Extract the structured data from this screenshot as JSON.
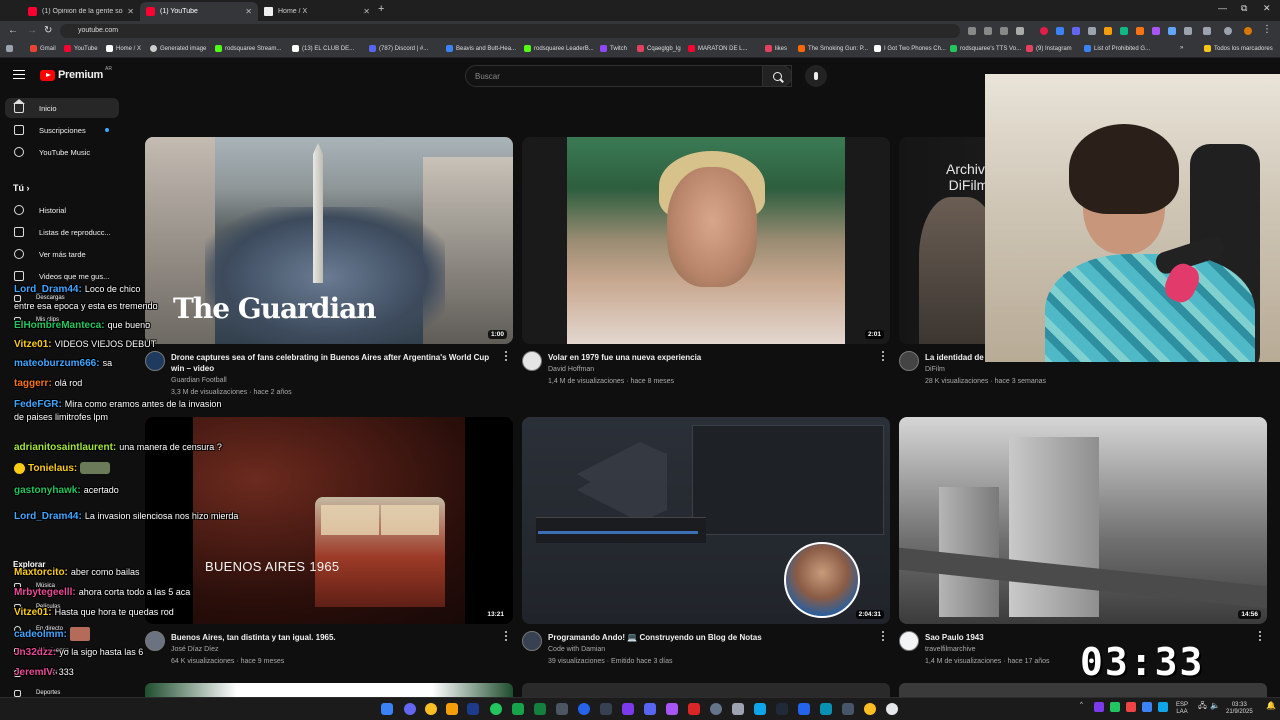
{
  "browser": {
    "tabs": [
      {
        "label": "(1) Opinion de la gente sobre e",
        "color": "#ff0033",
        "active": false
      },
      {
        "label": "(1) YouTube",
        "color": "#ff0033",
        "active": true
      },
      {
        "label": "Home / X",
        "color": "#ffffff",
        "active": false
      }
    ],
    "new_tab": "+",
    "url": "youtube.com",
    "window_controls": [
      "—",
      "⧉",
      "✕"
    ],
    "bookmarks": [
      {
        "label": "Gmail",
        "color": "#ea4335"
      },
      {
        "label": "YouTube",
        "color": "#ff0033"
      },
      {
        "label": "Home / X",
        "color": "#ffffff"
      },
      {
        "label": "Generated image",
        "color": "#cccccc"
      },
      {
        "label": "rodsquaree Stream...",
        "color": "#53fc18"
      },
      {
        "label": "(13) EL CLUB DE...",
        "color": "#ffffff"
      },
      {
        "label": "(787) Discord | #...",
        "color": "#5865f2"
      },
      {
        "label": "Beavis and Butt-Hea...",
        "color": "#3b82f6"
      },
      {
        "label": "rodsquaree LeaderB...",
        "color": "#53fc18"
      },
      {
        "label": "Twitch",
        "color": "#9146ff"
      },
      {
        "label": "Cqaeglgb_lg",
        "color": "#e4405f"
      },
      {
        "label": "MARATON DE L...",
        "color": "#ff0033"
      },
      {
        "label": "likes",
        "color": "#e4405f"
      },
      {
        "label": "The Smoking Gun: P...",
        "color": "#ff6600"
      },
      {
        "label": "I Got Two Phones Ch...",
        "color": "#ffffff"
      },
      {
        "label": "rodsquaree's TTS Vo...",
        "color": "#22c55e"
      },
      {
        "label": "(9) Instagram",
        "color": "#e4405f"
      },
      {
        "label": "List of Prohibited G...",
        "color": "#3b82f6"
      },
      {
        "label": "Todos los marcadores",
        "color": "#f5c518"
      }
    ]
  },
  "youtube": {
    "logo_text": "Premium",
    "logo_region": "AR",
    "search_placeholder": "Buscar",
    "sidebar": {
      "primary": [
        {
          "label": "Inicio",
          "icon": "home-icon",
          "active": true
        },
        {
          "label": "Suscripciones",
          "icon": "subscriptions-icon",
          "active": false
        },
        {
          "label": "YouTube Music",
          "icon": "music-icon",
          "active": false
        }
      ],
      "you_header": "Tú",
      "you_items": [
        {
          "label": "Historial",
          "icon": "history-icon"
        },
        {
          "label": "Listas de reproducc...",
          "icon": "playlist-icon"
        },
        {
          "label": "Ver más tarde",
          "icon": "clock-icon"
        },
        {
          "label": "Videos que me gus...",
          "icon": "thumbs-up-icon"
        },
        {
          "label": "Descargas",
          "icon": "download-icon"
        },
        {
          "label": "Mis clips",
          "icon": "scissors-icon"
        }
      ],
      "subs_header": "Suscripciones",
      "subs_items": [
        "Cuchicuchi",
        "¿Quieres qué...",
        "Subidos"
      ],
      "explore_header": "Explorar",
      "explore_items": [
        "Música",
        "Películas",
        "En directo",
        "Videojuegos",
        "Noticias",
        "Deportes"
      ]
    },
    "videos": [
      {
        "title": "Drone captures sea of fans celebrating in Buenos Aires after Argentina's World Cup win – video",
        "channel": "Guardian Football",
        "meta": "3,3 M de visualizaciones · hace 2 años",
        "duration": "1:00",
        "thumb_text": "The Guardian"
      },
      {
        "title": "Volar en 1979 fue una nueva experiencia",
        "channel": "David Hoffman",
        "meta": "1,4 M de visualizaciones · hace 8 meses",
        "duration": "2:01",
        "thumb_text": ""
      },
      {
        "title": "La identidad de",
        "channel": "DiFilm",
        "meta": "28 K visualizaciones · hace 3 semanas",
        "duration": "",
        "thumb_text": "Archivo DiFilm"
      },
      {
        "title": "Buenos Aires, tan distinta y tan igual. 1965.",
        "channel": "José Díaz Díez",
        "meta": "64 K visualizaciones · hace 9 meses",
        "duration": "13:21",
        "thumb_text": "BUENOS AIRES 1965"
      },
      {
        "title": "Programando Ando! 💻 Construyendo un Blog de Notas",
        "channel": "Code with Damian",
        "meta": "39 visualizaciones · Emitido hace 3 días",
        "duration": "2:04:31",
        "thumb_text": ""
      },
      {
        "title": "Sao Paulo 1943",
        "channel": "travelfilmarchive",
        "meta": "1,4 M de visualizaciones · hace 17 años",
        "duration": "14:56",
        "thumb_text": ""
      }
    ]
  },
  "stream_overlay": {
    "chat": [
      {
        "user": "Lord_Dram44:",
        "msg": "Loco de chico",
        "color": "#3ea6ff"
      },
      {
        "user": "",
        "msg": "entre esa epoca y esta es tremendo",
        "color": "#ffffff"
      },
      {
        "user": "ElHombreManteca:",
        "msg": "que bueno",
        "color": "#22c55e"
      },
      {
        "user": "Vitze01:",
        "msg": "VIDEOS VIEJOS DEBUT",
        "color": "#facc15"
      },
      {
        "user": "mateoburzum666:",
        "msg": "sa",
        "color": "#3ea6ff"
      },
      {
        "user": "taggerr:",
        "msg": "olá rod",
        "color": "#f97316"
      },
      {
        "user": "FedeFGR:",
        "msg": "Mira como eramos antes de la invasion de paises limitrofes lpm",
        "color": "#3ea6ff"
      },
      {
        "user": "adrianitosaintlaurent:",
        "msg": "una manera de censura ?",
        "color": "#a3e635"
      },
      {
        "user": "Tonielaus:",
        "msg": "",
        "color": "#facc15"
      },
      {
        "user": "gastonyhawk:",
        "msg": "acertado",
        "color": "#22c55e"
      },
      {
        "user": "Lord_Dram44:",
        "msg": "La invasion silenciosa nos hizo mierda",
        "color": "#3ea6ff"
      },
      {
        "user": "Maxtorcito:",
        "msg": "aber como bailas",
        "color": "#facc15"
      },
      {
        "user": "Mrbytegeelll:",
        "msg": "ahora corta todo a las 5 aca",
        "color": "#ec4899"
      },
      {
        "user": "Vitze01:",
        "msg": "Hasta que hora te quedas rod",
        "color": "#facc15"
      },
      {
        "user": "cadeolmm:",
        "msg": "",
        "color": "#3ea6ff"
      },
      {
        "user": "Jn32dzz:",
        "msg": "yo la sigo hasta las 6",
        "color": "#ec4899"
      },
      {
        "user": "JeremIV:",
        "msg": "333",
        "color": "#ec4899"
      }
    ],
    "timer": "03:33"
  },
  "taskbar": {
    "lang": "ESP",
    "layout": "LAA",
    "time": "03:33",
    "date": "21/9/2025"
  }
}
